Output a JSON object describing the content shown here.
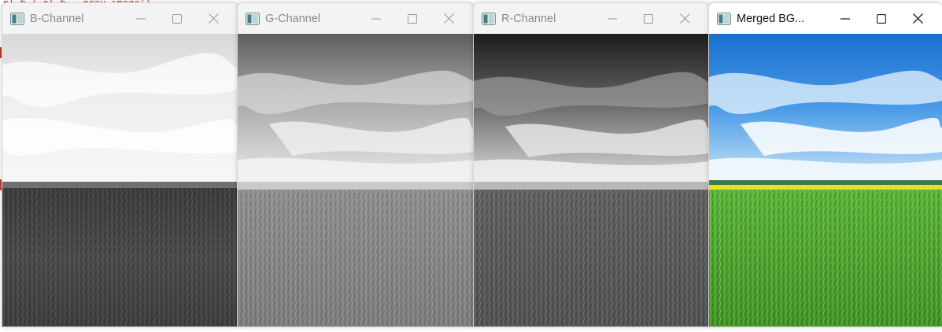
{
  "background": {
    "code_fragment": "pl.b ( ol_b ,   gray image')"
  },
  "windows": [
    {
      "title": "B-Channel",
      "channel": "blue",
      "image": "grayscale-landscape-blue-channel"
    },
    {
      "title": "G-Channel",
      "channel": "green",
      "image": "grayscale-landscape-green-channel"
    },
    {
      "title": "R-Channel",
      "channel": "red",
      "image": "grayscale-landscape-red-channel"
    },
    {
      "title": "Merged BG...",
      "channel": "merged",
      "image": "color-landscape-sky-and-field"
    }
  ],
  "controls": {
    "minimize_icon": "minimize-icon",
    "maximize_icon": "maximize-icon",
    "close_icon": "close-icon"
  },
  "colors": {
    "sky_blue": "#1f7fd6",
    "grass_green": "#4da52a",
    "canola_yellow": "#e8e12a"
  }
}
